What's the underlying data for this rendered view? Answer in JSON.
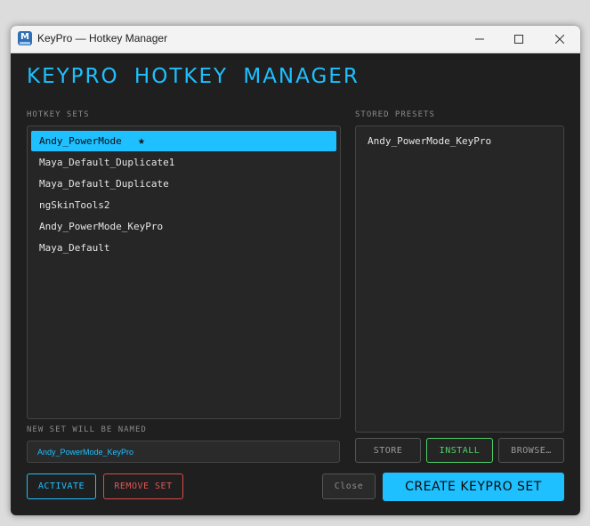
{
  "window": {
    "title": "KeyPro — Hotkey Manager",
    "app_icon_letter": "M"
  },
  "heading": "KEYPRO HOTKEY MANAGER",
  "hotkey_sets": {
    "label": "HOTKEY SETS",
    "items": [
      {
        "label": "Andy_PowerMode",
        "selected": true,
        "starred": true
      },
      {
        "label": "Maya_Default_Duplicate1",
        "selected": false
      },
      {
        "label": "Maya_Default_Duplicate",
        "selected": false
      },
      {
        "label": "ngSkinTools2",
        "selected": false
      },
      {
        "label": "Andy_PowerMode_KeyPro",
        "selected": false
      },
      {
        "label": "Maya_Default",
        "selected": false
      }
    ],
    "star_glyph": "★"
  },
  "stored_presets": {
    "label": "STORED PRESETS",
    "items": [
      {
        "label": "Andy_PowerMode_KeyPro"
      }
    ]
  },
  "new_set": {
    "label": "NEW SET WILL BE NAMED",
    "value": "Andy_PowerMode_KeyPro"
  },
  "buttons": {
    "store": "STORE",
    "install": "INSTALL",
    "browse": "BROWSE…",
    "activate": "ACTIVATE",
    "remove_set": "REMOVE SET",
    "close": "Close",
    "create": "CREATE KEYPRO SET"
  },
  "colors": {
    "accent": "#1ec0ff",
    "install_green": "#4fd06a",
    "remove_red": "#e05555",
    "background": "#1f1f1f"
  }
}
